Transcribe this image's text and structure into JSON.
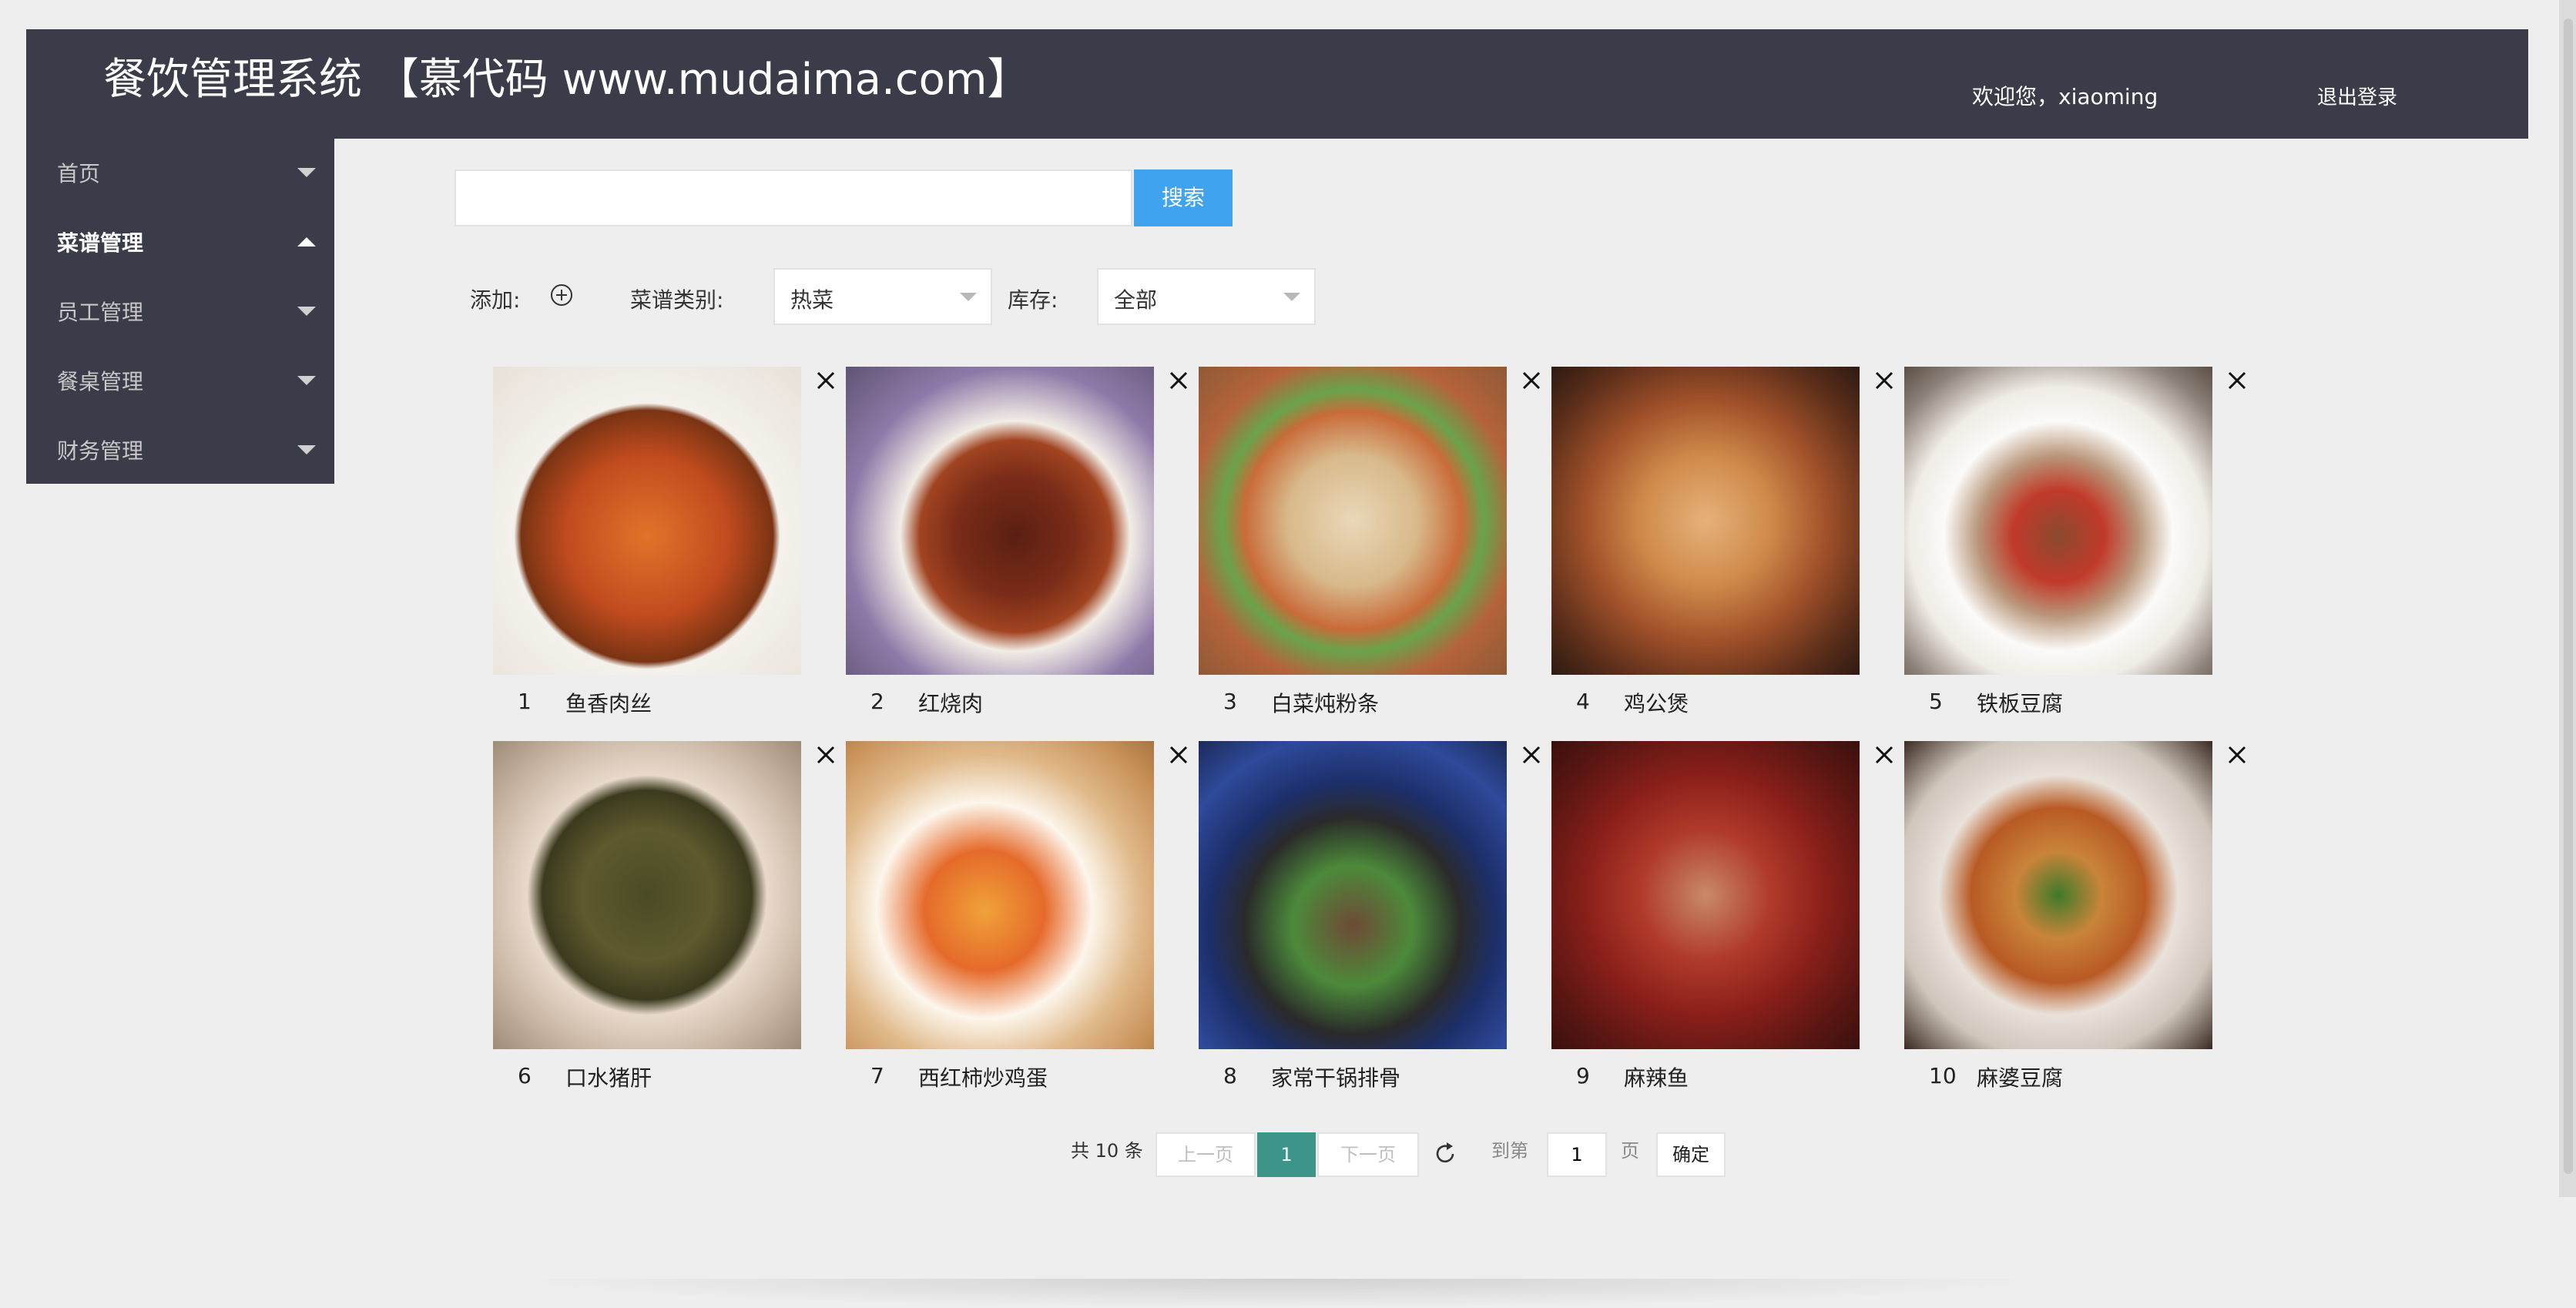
{
  "header": {
    "title": "餐饮管理系统 【慕代码 www.mudaima.com】",
    "welcome": "欢迎您，xiaoming",
    "logout": "退出登录"
  },
  "sidebar": {
    "items": [
      {
        "label": "首页",
        "expanded": false
      },
      {
        "label": "菜谱管理",
        "expanded": true
      },
      {
        "label": "员工管理",
        "expanded": false
      },
      {
        "label": "餐桌管理",
        "expanded": false
      },
      {
        "label": "财务管理",
        "expanded": false
      }
    ]
  },
  "search": {
    "value": "",
    "button_label": "搜索"
  },
  "filters": {
    "add_label": "添加:",
    "category_label": "菜谱类别:",
    "category_value": "热菜",
    "stock_label": "库存:",
    "stock_value": "全部"
  },
  "dishes": [
    {
      "num": "1",
      "name": "鱼香肉丝"
    },
    {
      "num": "2",
      "name": "红烧肉"
    },
    {
      "num": "3",
      "name": "白菜炖粉条"
    },
    {
      "num": "4",
      "name": "鸡公煲"
    },
    {
      "num": "5",
      "name": "铁板豆腐"
    },
    {
      "num": "6",
      "name": "口水猪肝"
    },
    {
      "num": "7",
      "name": "西红柿炒鸡蛋"
    },
    {
      "num": "8",
      "name": "家常干锅排骨"
    },
    {
      "num": "9",
      "name": "麻辣鱼"
    },
    {
      "num": "10",
      "name": "麻婆豆腐"
    }
  ],
  "pagination": {
    "total": "共 10 条",
    "prev": "上一页",
    "current": "1",
    "next": "下一页",
    "goto_label": "到第",
    "goto_value": "1",
    "page_unit": "页",
    "confirm": "确定"
  },
  "colors": {
    "header_bg": "#3a3d49",
    "search_button": "#3fa3ef",
    "pager_active": "#3d958a"
  }
}
